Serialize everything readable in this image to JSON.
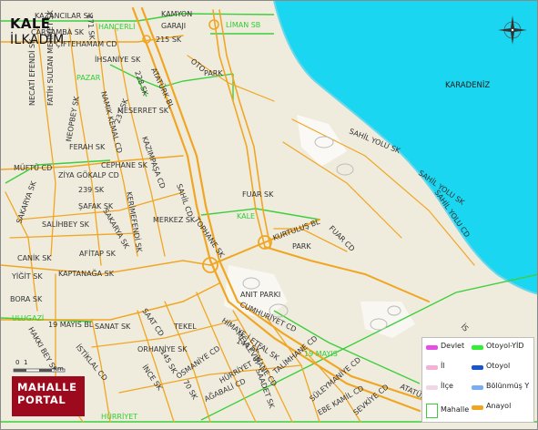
{
  "title": {
    "main": "KALE",
    "sub": "İLKADIM"
  },
  "sea": {
    "label": "KARADENİZ",
    "color": "#1ad6f0"
  },
  "colors": {
    "land": "#efecde",
    "road": "#f0a623",
    "mahalle_border": "#3ccf3c",
    "park": "#ffffff"
  },
  "neighborhoods": [
    "HANÇERLİ",
    "LİMAN SB",
    "PAZAR",
    "KALE",
    "ULUGAZİ",
    "19 MAYIS",
    "HÜRRİYET"
  ],
  "streets": {
    "kazancilar": "KAZANCILAR SK",
    "carsamba": "ÇARŞAMBA SK",
    "fatih_sultan_mehmet_cd": "FATİH SULTAN MEHMET CD",
    "tehamam": "ÇİFTEHAMAM CD",
    "kamyon": "KAMYON",
    "garaji": "GARAJI",
    "sk215": "215 SK",
    "ihsaniye": "İHSANİYE SK",
    "oto": "OTO",
    "park": "PARK",
    "necati": "NECATİ EFENDİ SK",
    "fatih_sk": "FATİH SULTAN MEHMET SK",
    "neopbey": "NEOPBEY SK",
    "namik_kemal": "NAMIK KEMAL CD",
    "ataturk": "ATATÜRK BL",
    "sk228": "228 SK",
    "sk271": "271 SK",
    "meserret": "MESERRET SK",
    "sk237": "237 SK",
    "kazimpasa": "KAZIMPAŞA CD",
    "ferah": "FERAH SK",
    "cephane": "CEPHANE SK",
    "muftu": "MÜFTÜ CD",
    "ziya_gokalp": "ZİYA GÖKALP CD",
    "sk239": "239 SK",
    "safak": "ŞAFAK SK",
    "kerimefendi": "KERİMEFENDİ SK",
    "sakarya": "SAKARYA SK",
    "salihbey": "SALİHBEY SK",
    "sahil_cd": "SAHİL CD",
    "merkez": "MERKEZ SK",
    "tophane": "TOPHANE SK",
    "fuar_sk": "FUAR SK",
    "fuar_cd": "FUAR CD",
    "kurtulus": "KURTULUŞ BL",
    "sahil_yolu_sk": "SAHİL YOLU SK",
    "sahil_yolu_cd": "SAHİL YOLU CD",
    "sahil_yolu_sk2": "SAHİL YOLU SK",
    "anit_parki": "ANIT PARKI",
    "park2": "PARK",
    "canik": "CANİK SK",
    "afitap": "AFİTAP SK",
    "kaptanaga": "KAPTANAĞA SK",
    "yigit": "YİĞİT SK",
    "sakarya2": "SAKARYA SK",
    "bora": "BORA SK",
    "mayis19_bl": "19 MAYIS BL",
    "sanat": "SANAT SK",
    "saat": "SAAT CD",
    "tekel": "TEKEL",
    "cumhuriyet": "CUMHURİYET CD",
    "sk144": "144 SK",
    "himaye": "HİMAYE-İ ETFAL SK",
    "mevlevihane": "MEVLEVİHANE CD",
    "hakki_bey": "HAKKI BEY SK",
    "orhaniye": "ORHANİYE SK",
    "sk145": "145 SK",
    "istiklal": "İSTİKLAL CD",
    "ince": "İNCE SK",
    "osmaniye": "OSMANİYE CD",
    "sk70": "70 SK",
    "hurriyet": "HÜRRİYET SK",
    "saadet": "SAADET SK",
    "talimhane": "TALİMHANE CD",
    "suleymaniye": "SÜLEYMANİYE CD",
    "agabali": "AĞABALİ CD",
    "ebe": "EBE KAMİL CD",
    "sevkiye": "SEVKİYE CD",
    "ataturk_bl2": "ATATÜRK BL",
    "is": "İS"
  },
  "scale": {
    "val0": "0",
    "val1": "1",
    "unit": "km"
  },
  "logo": {
    "line1": "MAHALLE",
    "line2": "PORTAL"
  },
  "legend": [
    {
      "label": "Devlet",
      "color": "#e64ce6",
      "kind": "line"
    },
    {
      "label": "Otoyol-YİD",
      "color": "#33ee33",
      "kind": "line"
    },
    {
      "label": "İl",
      "color": "#f5b0d8",
      "kind": "line"
    },
    {
      "label": "Otoyol",
      "color": "#1a55d0",
      "kind": "line"
    },
    {
      "label": "İlçe",
      "color": "#f2d6e8",
      "kind": "line"
    },
    {
      "label": "Bölünmüş Y",
      "color": "#7aaef0",
      "kind": "line"
    },
    {
      "label": "Mahalle",
      "color": "#3ccf3c",
      "kind": "box"
    },
    {
      "label": "Anayol",
      "color": "#f0a623",
      "kind": "line"
    }
  ]
}
